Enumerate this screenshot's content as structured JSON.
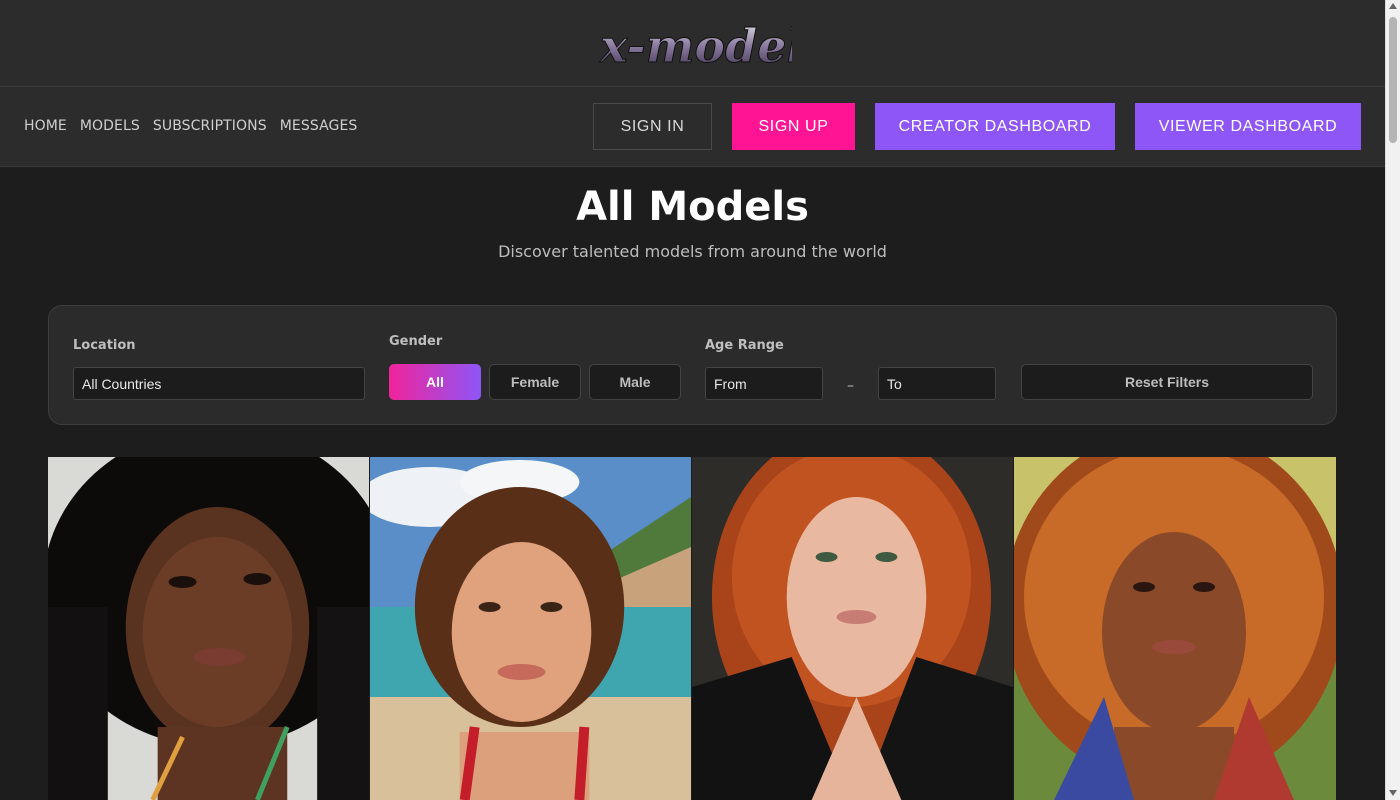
{
  "brand": {
    "logo_text": "x-models"
  },
  "nav": {
    "links": [
      "HOME",
      "MODELS",
      "SUBSCRIPTIONS",
      "MESSAGES"
    ],
    "sign_in": "SIGN IN",
    "sign_up": "SIGN UP",
    "creator_dashboard": "CREATOR DASHBOARD",
    "viewer_dashboard": "VIEWER DASHBOARD"
  },
  "page": {
    "title": "All Models",
    "subtitle": "Discover talented models from around the world"
  },
  "filters": {
    "location_label": "Location",
    "location_value": "All Countries",
    "gender_label": "Gender",
    "gender_options": [
      "All",
      "Female",
      "Male"
    ],
    "gender_selected": "All",
    "age_label": "Age Range",
    "age_from": "From",
    "age_dash": "–",
    "age_to": "To",
    "reset": "Reset Filters"
  },
  "models": [
    {
      "image": "portrait-dark-curly-hair"
    },
    {
      "image": "portrait-beach-short-hair"
    },
    {
      "image": "portrait-red-curly-hair-leather-jacket"
    },
    {
      "image": "portrait-auburn-curly-hair-sunset"
    }
  ],
  "colors": {
    "background": "#1d1d1d",
    "panel": "#2c2c2c",
    "sign_up": "#ff1493",
    "dashboard": "#8e56f7",
    "gradient_start": "#f0249a",
    "gradient_end": "#8e56f7"
  }
}
